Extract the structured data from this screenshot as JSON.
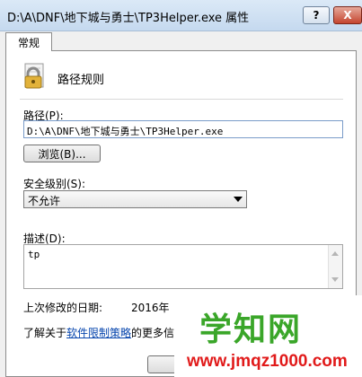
{
  "window": {
    "title": "D:\\A\\DNF\\地下城与勇士\\TP3Helper.exe 属性",
    "help_label": "?",
    "close_label": "X"
  },
  "tabs": [
    {
      "label": "常规"
    }
  ],
  "rule": {
    "title": "路径规则",
    "icon": "lock-icon"
  },
  "path": {
    "label": "路径(P):",
    "value": "D:\\A\\DNF\\地下城与勇士\\TP3Helper.exe"
  },
  "browse": {
    "label": "浏览(B)..."
  },
  "security": {
    "label": "安全级别(S):",
    "selected": "不允许"
  },
  "description": {
    "label": "描述(D):",
    "value": "tp"
  },
  "modified": {
    "label": "上次修改的日期:",
    "value": "2016年"
  },
  "learn_more": {
    "prefix": "了解关于",
    "link": "软件限制策略",
    "suffix": "的更多信"
  },
  "watermark": {
    "cn": "学知网",
    "url": "www.jmqz1000.com"
  }
}
